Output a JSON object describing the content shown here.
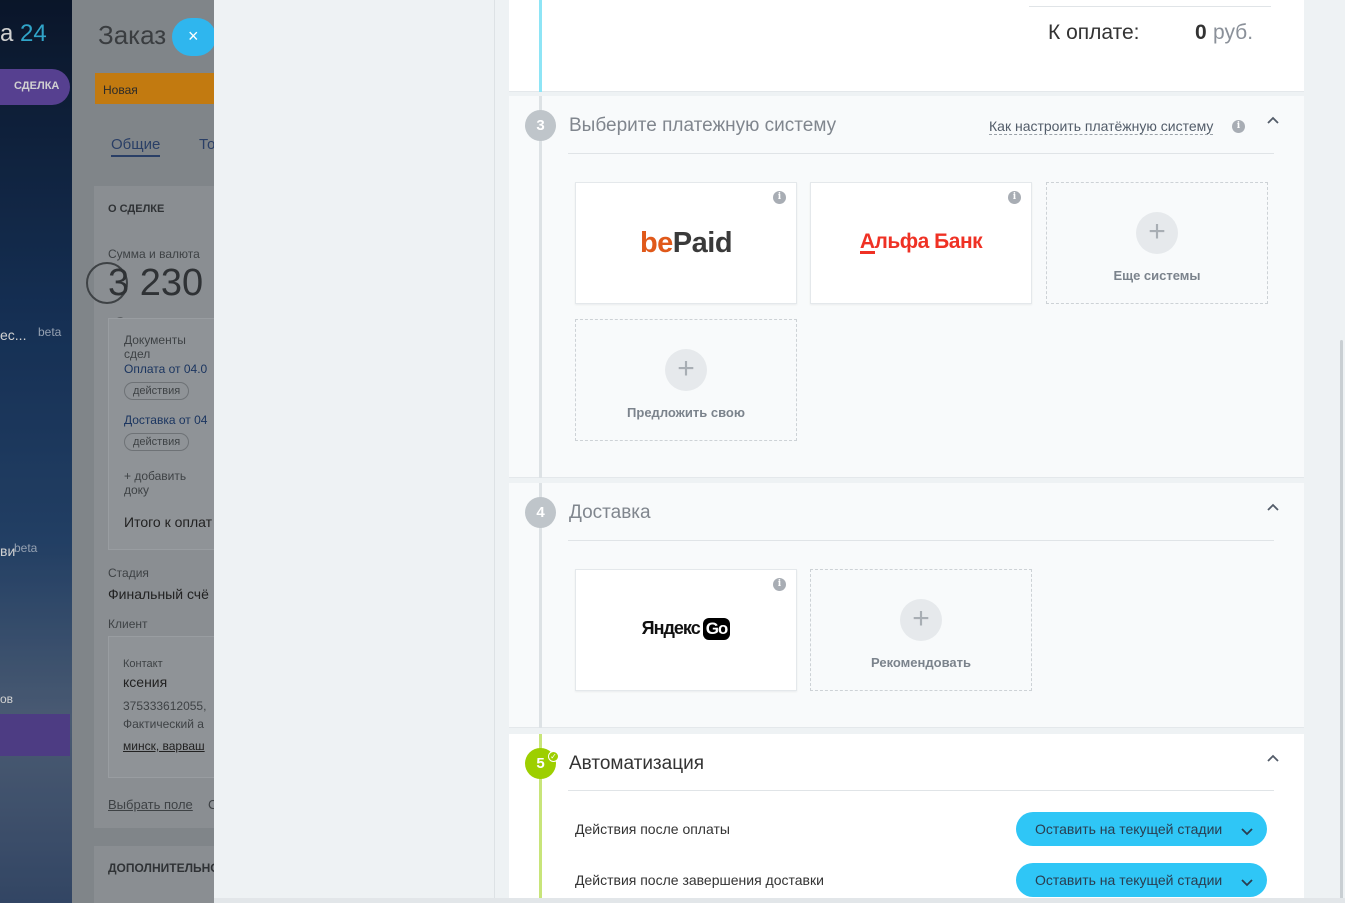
{
  "background_app": {
    "logo_fragment": "а",
    "logo_number": "24",
    "deal_pill": "СДЕЛКА",
    "menu_fragment_1": "ес...",
    "beta_1": "beta",
    "menu_fragment_2": "ви",
    "beta_2": "beta",
    "menu_fragment_3": "ов"
  },
  "deal_card": {
    "title": "Заказ",
    "close_glyph": "×",
    "stage": "Новая",
    "tab_general": "Общие",
    "tab_products": "То",
    "about_header": "О СДЕЛКЕ",
    "sum_label": "Сумма и валюта",
    "sum_value": "3 230",
    "sum_currency_fragment": "р",
    "docs_label": "Документы сдел",
    "doc_payment": "Оплата от 04.0",
    "doc_delivery": "Доставка от 04",
    "actions_1": "действия",
    "actions_2": "действия",
    "add_document": "+ добавить доку",
    "total_fragment": "Итого к оплат",
    "stage_label": "Стадия",
    "stage_value": "Финальный счё",
    "client_label": "Клиент",
    "contact_label": "Контакт",
    "contact_name": "ксения",
    "contact_phone": "375333612055,",
    "contact_address_label": "Фактический а",
    "contact_address": "минск, варваш",
    "select_field": "Выбрать поле",
    "select_field_2": "С",
    "additional_header": "ДОПОЛНИТЕЛЬНО"
  },
  "order": {
    "total_label": "К оплате:",
    "total_value": "0",
    "total_currency": "руб."
  },
  "payment_section": {
    "step": "3",
    "title": "Выберите платежную систему",
    "setup_link": "Как настроить платёжную систему",
    "info_glyph": "i",
    "systems": [
      {
        "logo_prefix": "be",
        "logo_rest": "Paid"
      },
      {
        "logo_first": "А",
        "logo_rest": "льфа Банк"
      }
    ],
    "more_label": "Еще системы",
    "suggest_label": "Предложить свою",
    "plus_glyph": "+"
  },
  "delivery_section": {
    "step": "4",
    "title": "Доставка",
    "service": {
      "logo_text": "Яндекс",
      "logo_badge": "Go"
    },
    "recommend_label": "Рекомендовать"
  },
  "automation_section": {
    "step": "5",
    "check_glyph": "✓",
    "title": "Автоматизация",
    "after_payment_label": "Действия после оплаты",
    "after_payment_value": "Оставить на текущей стадии",
    "after_delivery_label": "Действия после завершения доставки",
    "after_delivery_value": "Оставить на текущей стадии"
  },
  "colors": {
    "accent_blue": "#2fc6f6",
    "step_green": "#9dcf00",
    "step_grey": "#bfc5ca",
    "stage_orange": "#c27a10",
    "bepaid_orange": "#e0591a",
    "alfa_red": "#ef3124"
  }
}
